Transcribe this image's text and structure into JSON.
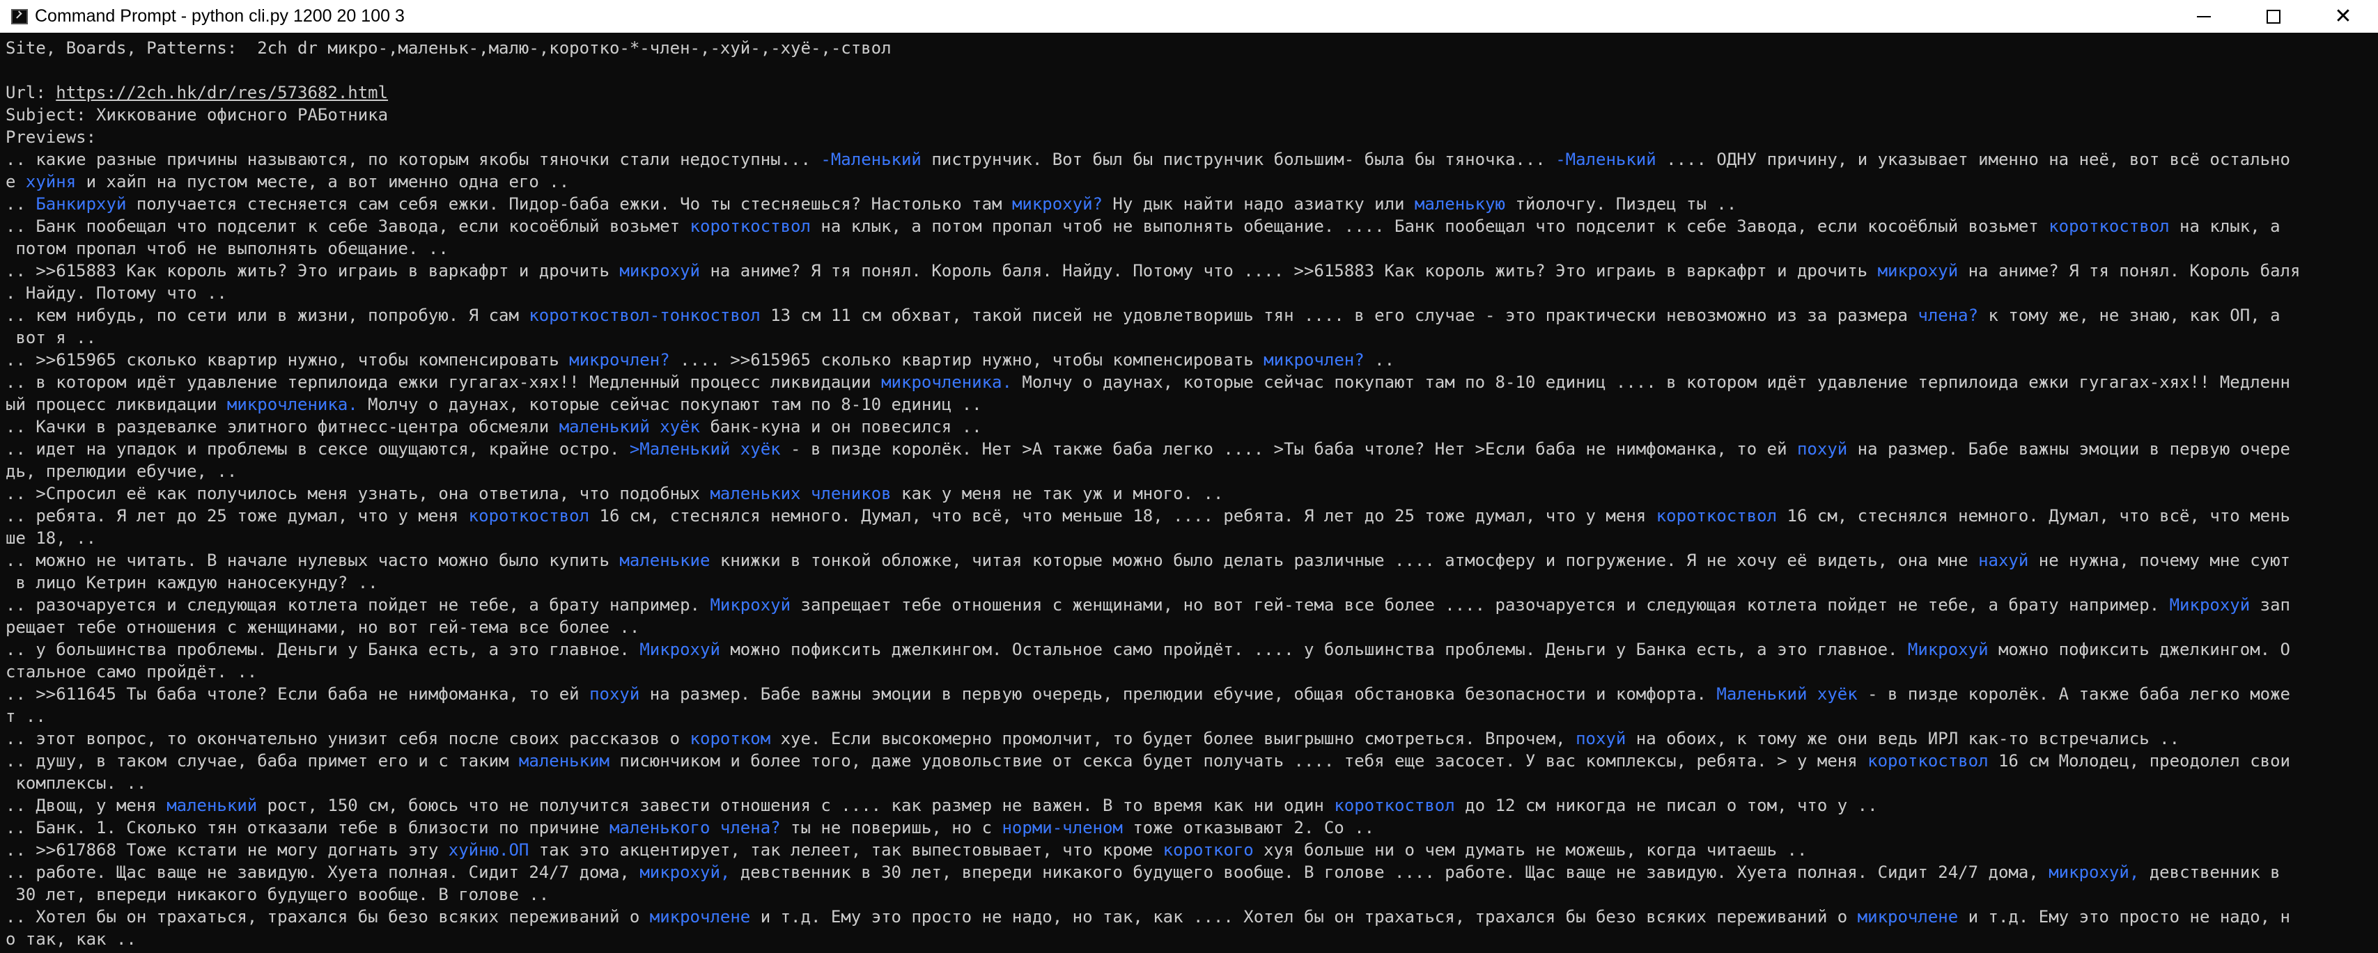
{
  "window": {
    "title": "Command Prompt - python  cli.py 1200 20 100 3",
    "icon": "cmd-icon",
    "minimize_icon": "minimize-icon",
    "maximize_icon": "maximize-icon",
    "close_icon": "close-icon"
  },
  "colors": {
    "background": "#0c0c0c",
    "text": "#cccccc",
    "highlight": "#3b78ff",
    "titlebar": "#ffffff"
  },
  "console": {
    "lines": [
      [
        {
          "t": "Site, Boards, Patterns:  2ch dr микро-,маленьк-,малю-,коротко-*-член-,-хуй-,-хуё-,-ствол"
        }
      ],
      [
        {
          "t": ""
        }
      ],
      [
        {
          "t": "Url: "
        },
        {
          "t": "https://2ch.hk/dr/res/573682.html",
          "u": 1
        }
      ],
      [
        {
          "t": "Subject: Хиккование офисного РАБотника"
        }
      ],
      [
        {
          "t": "Previews:"
        }
      ],
      [
        {
          "t": ".. какие разные причины называются, по которым якобы тяночки стали недоступны... "
        },
        {
          "t": "-Маленький",
          "h": 1
        },
        {
          "t": " пиструнчик. Вот был бы пиструнчик большим- была бы тяночка... "
        },
        {
          "t": "-Маленький",
          "h": 1
        },
        {
          "t": " .... ОДНУ причину, и указывает именно на неё, вот всё остально"
        }
      ],
      [
        {
          "t": "е "
        },
        {
          "t": "хуйня",
          "h": 1
        },
        {
          "t": " и хайп на пустом месте, а вот именно одна его .."
        }
      ],
      [
        {
          "t": ".. "
        },
        {
          "t": "Банкирхуй",
          "h": 1
        },
        {
          "t": " получается стесняется сам себя ежки. Пидор-баба ежки. Чо ты стесняешься? Настолько там "
        },
        {
          "t": "микрохуй?",
          "h": 1
        },
        {
          "t": " Ну дык найти надо азиатку или "
        },
        {
          "t": "маленькую",
          "h": 1
        },
        {
          "t": " тйолочгу. Пиздец ты .."
        }
      ],
      [
        {
          "t": ".. Банк пообещал что подселит к себе Завода, если косоёблый возьмет "
        },
        {
          "t": "короткоствол",
          "h": 1
        },
        {
          "t": " на клык, а потом пропал чтоб не выполнять обещание. .... Банк пообещал что подселит к себе Завода, если косоёблый возьмет "
        },
        {
          "t": "короткоствол",
          "h": 1
        },
        {
          "t": " на клык, а"
        }
      ],
      [
        {
          "t": " потом пропал чтоб не выполнять обещание. .."
        }
      ],
      [
        {
          "t": ".. >>615883 Как король жить? Это играиь в варкафрт и дрочить "
        },
        {
          "t": "микрохуй",
          "h": 1
        },
        {
          "t": " на аниме? Я тя понял. Король баля. Найду. Потому что .... >>615883 Как король жить? Это играиь в варкафрт и дрочить "
        },
        {
          "t": "микрохуй",
          "h": 1
        },
        {
          "t": " на аниме? Я тя понял. Король баля"
        }
      ],
      [
        {
          "t": ". Найду. Потому что .."
        }
      ],
      [
        {
          "t": ".. кем нибудь, по сети или в жизни, попробую. Я сам "
        },
        {
          "t": "короткоствол-тонкоствол",
          "h": 1
        },
        {
          "t": " 13 см 11 см обхват, такой писей не удовлетворишь тян .... в его случае - это практически невозможно из за размера "
        },
        {
          "t": "члена?",
          "h": 1
        },
        {
          "t": " к тому же, не знаю, как ОП, а"
        }
      ],
      [
        {
          "t": " вот я .."
        }
      ],
      [
        {
          "t": ".. >>615965 сколько квартир нужно, чтобы компенсировать "
        },
        {
          "t": "микрочлен?",
          "h": 1
        },
        {
          "t": " .... >>615965 сколько квартир нужно, чтобы компенсировать "
        },
        {
          "t": "микрочлен?",
          "h": 1
        },
        {
          "t": " .."
        }
      ],
      [
        {
          "t": ".. в котором идёт удавление терпилоида ежки гугагах-хях!! Медленный процесс ликвидации "
        },
        {
          "t": "микрочленика.",
          "h": 1
        },
        {
          "t": " Молчу о даунах, которые сейчас покупают там по 8-10 единиц .... в котором идёт удавление терпилоида ежки гугагах-хях!! Медленн"
        }
      ],
      [
        {
          "t": "ый процесс ликвидации "
        },
        {
          "t": "микрочленика.",
          "h": 1
        },
        {
          "t": " Молчу о даунах, которые сейчас покупают там по 8-10 единиц .."
        }
      ],
      [
        {
          "t": ".. Качки в раздевалке элитного фитнесс-центра обсмеяли "
        },
        {
          "t": "маленький хуёк",
          "h": 1
        },
        {
          "t": " банк-куна и он повесился .."
        }
      ],
      [
        {
          "t": ".. идет на упадок и проблемы в сексе ощущаются, крайне остро. "
        },
        {
          "t": ">Маленький хуёк",
          "h": 1
        },
        {
          "t": " - в пизде королёк. Нет >А также баба легко .... >Ты баба чтоле? Нет >Если баба не нимфоманка, то ей "
        },
        {
          "t": "похуй",
          "h": 1
        },
        {
          "t": " на размер. Бабе важны эмоции в первую очере"
        }
      ],
      [
        {
          "t": "дь, прелюдии ебучие, .."
        }
      ],
      [
        {
          "t": ".. >Спросил её как получилось меня узнать, она ответила, что подобных "
        },
        {
          "t": "маленьких члеников",
          "h": 1
        },
        {
          "t": " как у меня не так уж и много. .."
        }
      ],
      [
        {
          "t": ".. ребята. Я лет до 25 тоже думал, что у меня "
        },
        {
          "t": "короткоствол",
          "h": 1
        },
        {
          "t": " 16 см, стеснялся немного. Думал, что всё, что меньше 18, .... ребята. Я лет до 25 тоже думал, что у меня "
        },
        {
          "t": "короткоствол",
          "h": 1
        },
        {
          "t": " 16 см, стеснялся немного. Думал, что всё, что мень"
        }
      ],
      [
        {
          "t": "ше 18, .."
        }
      ],
      [
        {
          "t": ".. можно не читать. В начале нулевых часто можно было купить "
        },
        {
          "t": "маленькие",
          "h": 1
        },
        {
          "t": " книжки в тонкой обложке, читая которые можно было делать различные .... атмосферу и погружение. Я не хочу её видеть, она мне "
        },
        {
          "t": "нахуй",
          "h": 1
        },
        {
          "t": " не нужна, почему мне суют"
        }
      ],
      [
        {
          "t": " в лицо Кетрин каждую наносекунду? .."
        }
      ],
      [
        {
          "t": ".. разочаруется и следующая котлета пойдет не тебе, а брату например. "
        },
        {
          "t": "Микрохуй",
          "h": 1
        },
        {
          "t": " запрещает тебе отношения с женщинами, но вот гей-тема все более .... разочаруется и следующая котлета пойдет не тебе, а брату например. "
        },
        {
          "t": "Микрохуй",
          "h": 1
        },
        {
          "t": " зап"
        }
      ],
      [
        {
          "t": "рещает тебе отношения с женщинами, но вот гей-тема все более .."
        }
      ],
      [
        {
          "t": ".. у большинства проблемы. Деньги у Банка есть, а это главное. "
        },
        {
          "t": "Микрохуй",
          "h": 1
        },
        {
          "t": " можно пофиксить джелкингом. Остальное само пройдёт. .... у большинства проблемы. Деньги у Банка есть, а это главное. "
        },
        {
          "t": "Микрохуй",
          "h": 1
        },
        {
          "t": " можно пофиксить джелкингом. О"
        }
      ],
      [
        {
          "t": "стальное само пройдёт. .."
        }
      ],
      [
        {
          "t": ".. >>611645 Ты баба чтоле? Если баба не нимфоманка, то ей "
        },
        {
          "t": "похуй",
          "h": 1
        },
        {
          "t": " на размер. Бабе важны эмоции в первую очередь, прелюдии ебучие, общая обстановка безопасности и комфорта. "
        },
        {
          "t": "Маленький хуёк",
          "h": 1
        },
        {
          "t": " - в пизде королёк. А также баба легко може"
        }
      ],
      [
        {
          "t": "т .."
        }
      ],
      [
        {
          "t": ".. этот вопрос, то окончательно унизит себя после своих рассказов о "
        },
        {
          "t": "коротком",
          "h": 1
        },
        {
          "t": " хуе. Если высокомерно промолчит, то будет более выигрышно смотреться. Впрочем, "
        },
        {
          "t": "похуй",
          "h": 1
        },
        {
          "t": " на обоих, к тому же они ведь ИРЛ как-то встречались .."
        }
      ],
      [
        {
          "t": ".. душу, в таком случае, баба примет его и с таким "
        },
        {
          "t": "маленьким",
          "h": 1
        },
        {
          "t": " писюнчиком и более того, даже удовольствие от секса будет получать .... тебя еще засосет. У вас комплексы, ребята. > у меня "
        },
        {
          "t": "короткоствол",
          "h": 1
        },
        {
          "t": " 16 см Молодец, преодолел свои"
        }
      ],
      [
        {
          "t": " комплексы. .."
        }
      ],
      [
        {
          "t": ".. Двощ, у меня "
        },
        {
          "t": "маленький",
          "h": 1
        },
        {
          "t": " рост, 150 см, боюсь что не получится завести отношения с .... как размер не важен. В то время как ни один "
        },
        {
          "t": "короткоствол",
          "h": 1
        },
        {
          "t": " до 12 см никогда не писал о том, что у .."
        }
      ],
      [
        {
          "t": ".. Банк. 1. Сколько тян отказали тебе в близости по причине "
        },
        {
          "t": "маленького члена?",
          "h": 1
        },
        {
          "t": " ты не поверишь, но с "
        },
        {
          "t": "норми-членом",
          "h": 1
        },
        {
          "t": " тоже отказывают 2. Со .."
        }
      ],
      [
        {
          "t": ".. >>617868 Тоже кстати не могу догнать эту "
        },
        {
          "t": "хуйню.ОП",
          "h": 1
        },
        {
          "t": " так это акцентирует, так лелеет, так выпестовывает, что кроме "
        },
        {
          "t": "короткого",
          "h": 1
        },
        {
          "t": " хуя больше ни о чем думать не можешь, когда читаешь .."
        }
      ],
      [
        {
          "t": ".. работе. Щас ваще не завидую. Хуета полная. Сидит 24/7 дома, "
        },
        {
          "t": "микрохуй,",
          "h": 1
        },
        {
          "t": " девственник в 30 лет, впереди никакого будущего вообще. В голове .... работе. Щас ваще не завидую. Хуета полная. Сидит 24/7 дома, "
        },
        {
          "t": "микрохуй,",
          "h": 1
        },
        {
          "t": " девственник в"
        }
      ],
      [
        {
          "t": " 30 лет, впереди никакого будущего вообще. В голове .."
        }
      ],
      [
        {
          "t": ".. Хотел бы он трахаться, трахался бы безо всяких переживаний о "
        },
        {
          "t": "микрочлене",
          "h": 1
        },
        {
          "t": " и т.д. Ему это просто не надо, но так, как .... Хотел бы он трахаться, трахался бы безо всяких переживаний о "
        },
        {
          "t": "микрочлене",
          "h": 1
        },
        {
          "t": " и т.д. Ему это просто не надо, н"
        }
      ],
      [
        {
          "t": "о так, как .."
        }
      ]
    ]
  }
}
